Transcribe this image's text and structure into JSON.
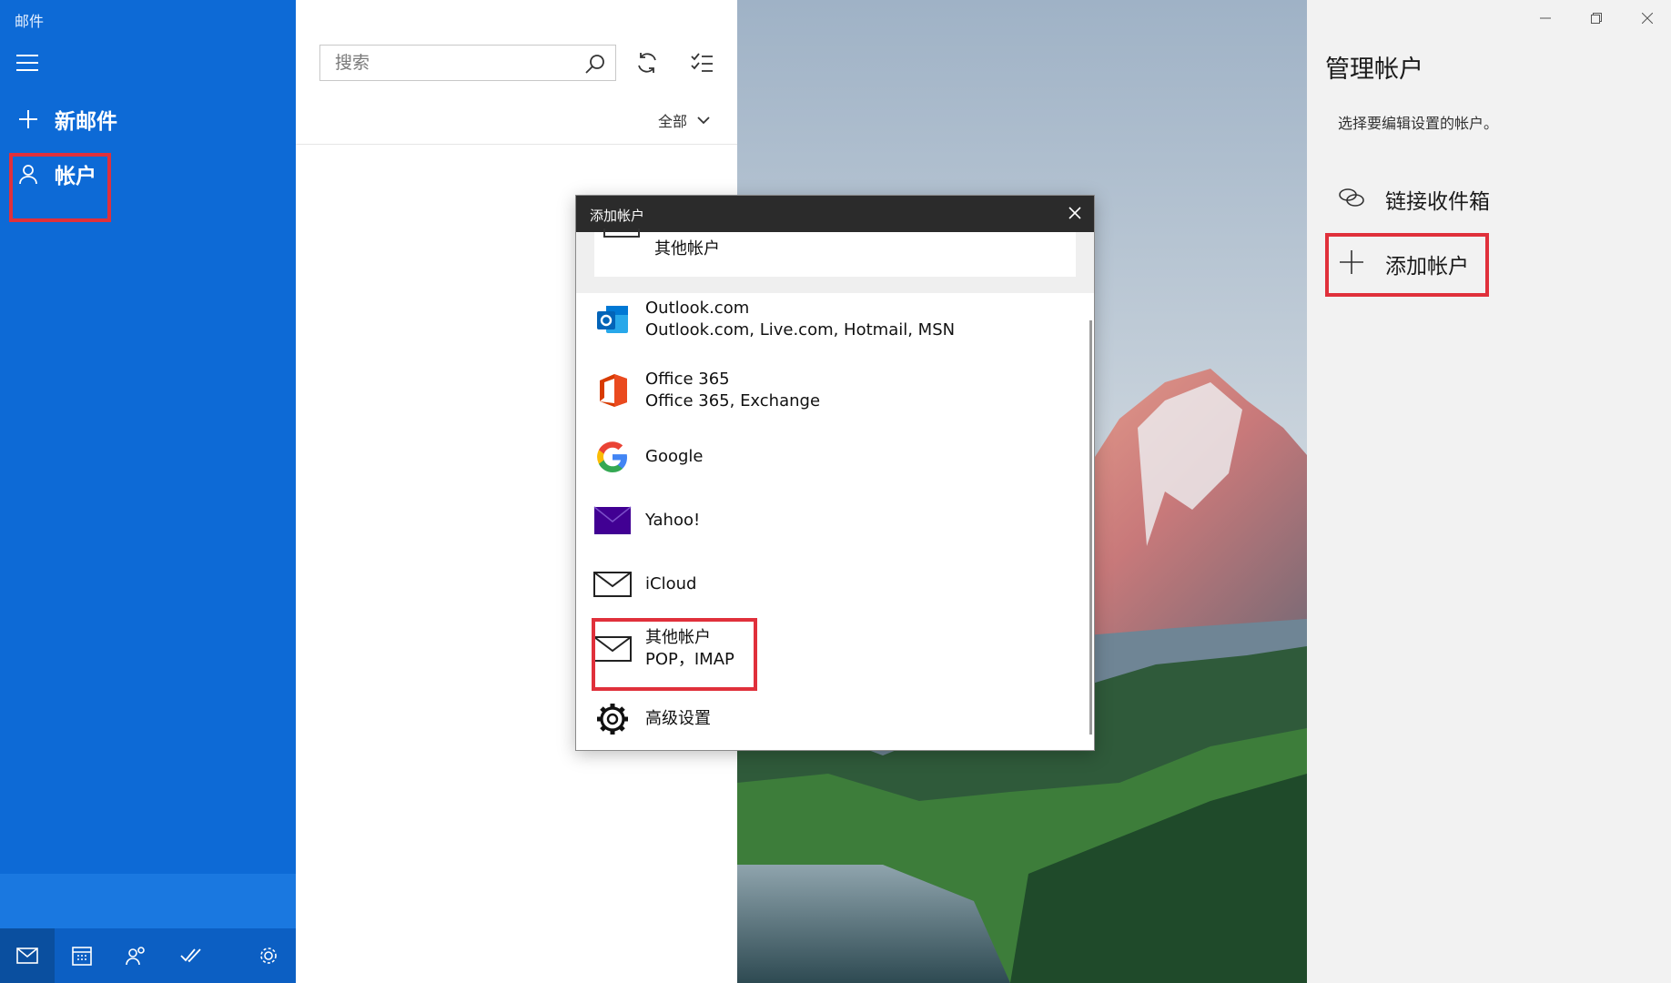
{
  "app": {
    "title": "邮件"
  },
  "nav": {
    "new_mail": "新邮件",
    "accounts": "帐户"
  },
  "list": {
    "search_placeholder": "搜索",
    "filter_label": "全部"
  },
  "settings": {
    "title": "管理帐户",
    "subtitle": "选择要编辑设置的帐户。",
    "link_inboxes": "链接收件箱",
    "add_account": "添加帐户"
  },
  "dialog": {
    "title": "添加帐户",
    "ghost_item": "其他帐户",
    "providers": [
      {
        "name": "Outlook.com",
        "detail": "Outlook.com, Live.com, Hotmail, MSN",
        "icon": "outlook-icon"
      },
      {
        "name": "Office 365",
        "detail": "Office 365, Exchange",
        "icon": "office-icon"
      },
      {
        "name": "Google",
        "detail": "",
        "icon": "google-icon"
      },
      {
        "name": "Yahoo!",
        "detail": "",
        "icon": "yahoo-icon"
      },
      {
        "name": "iCloud",
        "detail": "",
        "icon": "envelope-icon"
      },
      {
        "name": "其他帐户",
        "detail": "POP，IMAP",
        "icon": "envelope-icon"
      },
      {
        "name": "高级设置",
        "detail": "",
        "icon": "gear-icon"
      }
    ]
  },
  "colors": {
    "sidebar": "#0d6ad6",
    "highlight": "#e0303b",
    "dialog_header": "#2b2b2b",
    "yahoo": "#410093"
  }
}
